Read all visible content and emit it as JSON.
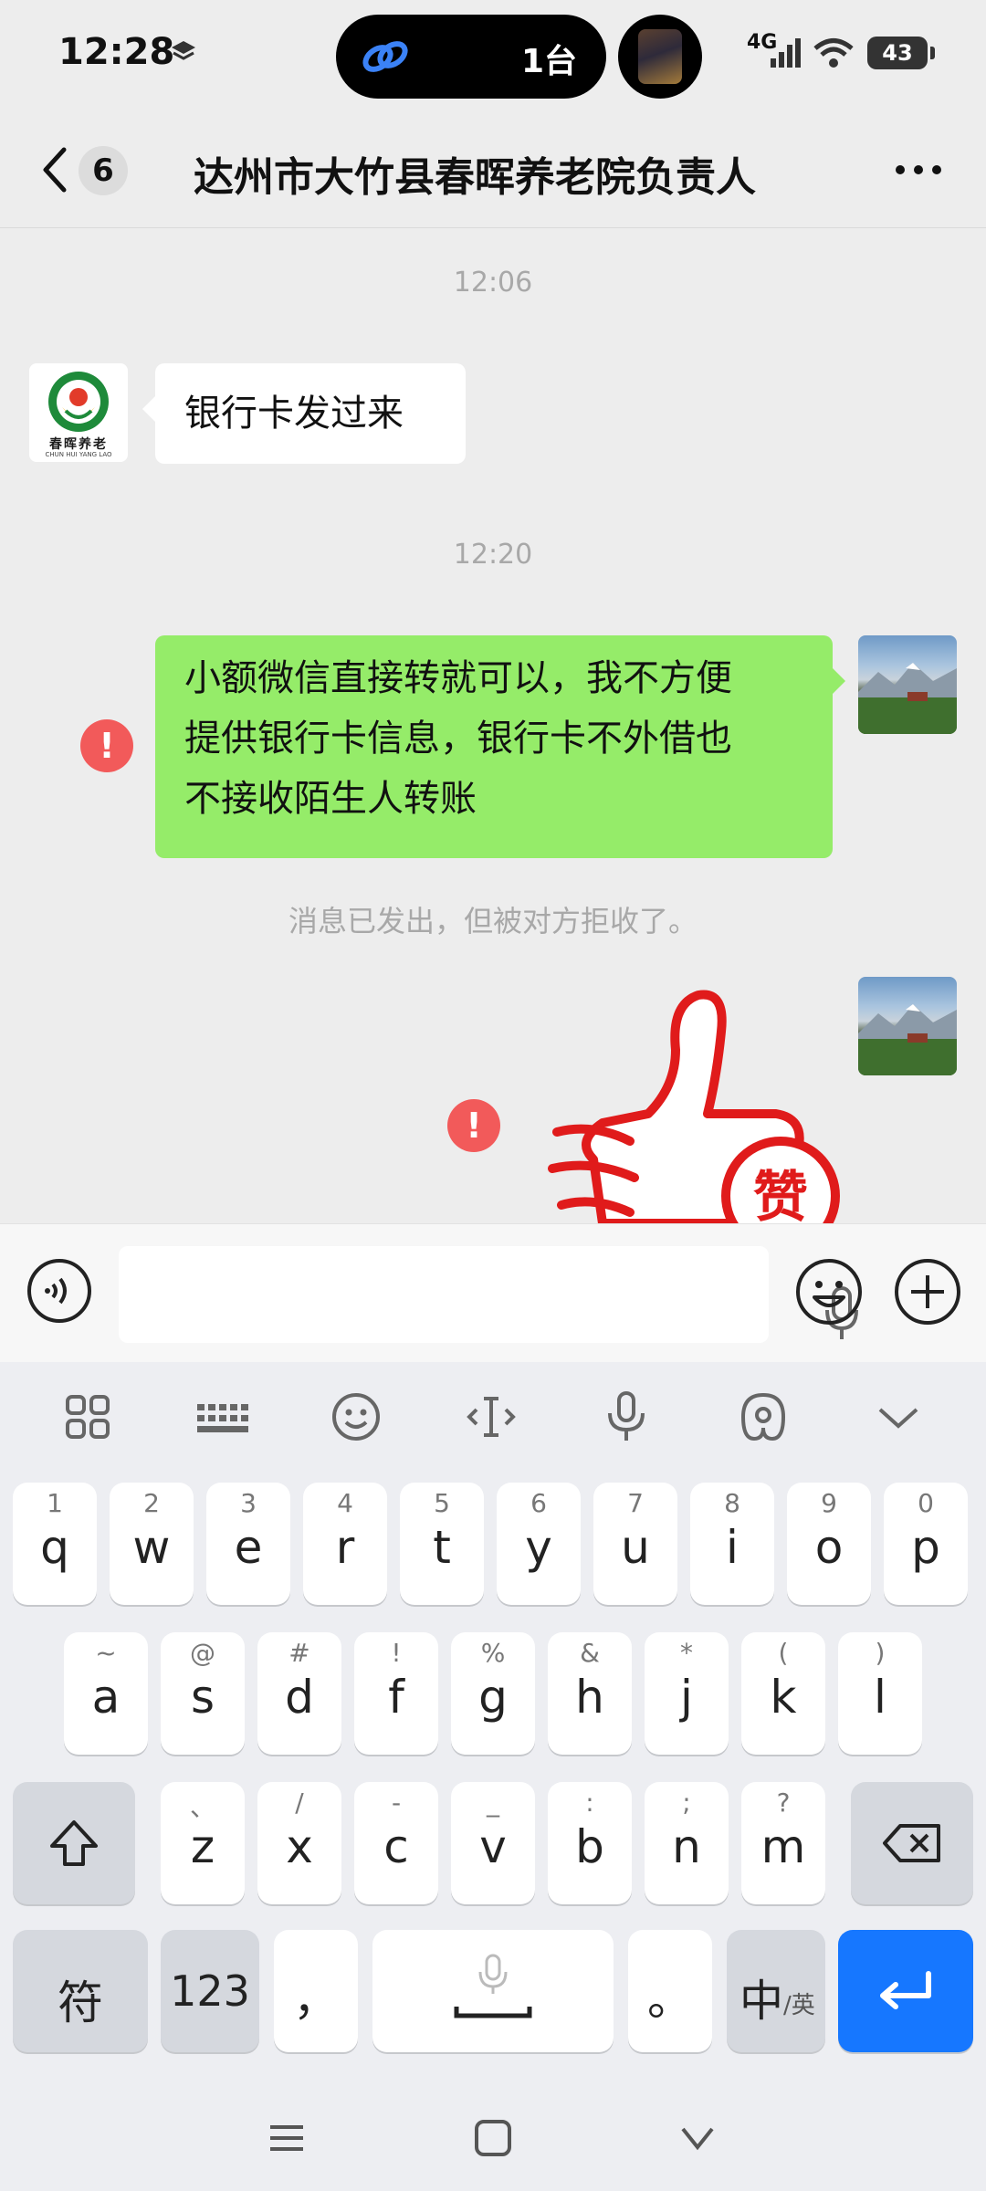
{
  "status_bar": {
    "time": "12:28",
    "island_label": "1台",
    "network": "4G",
    "battery": "43"
  },
  "header": {
    "unread_count": "6",
    "title": "达州市大竹县春晖养老院负责人"
  },
  "messages": {
    "ts1": "12:06",
    "msg1": "银行卡发过来",
    "avatar_logo_text": "春晖养老",
    "avatar_logo_sub": "CHUN HUI YANG LAO",
    "ts2": "12:20",
    "msg2_line1": "小额微信直接转就可以，我不方便",
    "msg2_line2": "提供银行卡信息，银行卡不外借也",
    "msg2_line3": "不接收陌生人转账",
    "rejected_notice": "消息已发出，但被对方拒收了。",
    "error_mark": "!",
    "sticker_text": "赞"
  },
  "keyboard": {
    "row1": [
      {
        "hint": "1",
        "key": "q"
      },
      {
        "hint": "2",
        "key": "w"
      },
      {
        "hint": "3",
        "key": "e"
      },
      {
        "hint": "4",
        "key": "r"
      },
      {
        "hint": "5",
        "key": "t"
      },
      {
        "hint": "6",
        "key": "y"
      },
      {
        "hint": "7",
        "key": "u"
      },
      {
        "hint": "8",
        "key": "i"
      },
      {
        "hint": "9",
        "key": "o"
      },
      {
        "hint": "0",
        "key": "p"
      }
    ],
    "row2": [
      {
        "hint": "~",
        "key": "a"
      },
      {
        "hint": "@",
        "key": "s"
      },
      {
        "hint": "#",
        "key": "d"
      },
      {
        "hint": "!",
        "key": "f"
      },
      {
        "hint": "%",
        "key": "g"
      },
      {
        "hint": "&",
        "key": "h"
      },
      {
        "hint": "*",
        "key": "j"
      },
      {
        "hint": "(",
        "key": "k"
      },
      {
        "hint": ")",
        "key": "l"
      }
    ],
    "row3": [
      {
        "hint": "、",
        "key": "z"
      },
      {
        "hint": "/",
        "key": "x"
      },
      {
        "hint": "-",
        "key": "c"
      },
      {
        "hint": "_",
        "key": "v"
      },
      {
        "hint": ":",
        "key": "b"
      },
      {
        "hint": ";",
        "key": "n"
      },
      {
        "hint": "?",
        "key": "m"
      }
    ],
    "sym": "符",
    "num": "123",
    "comma": "，",
    "period": "。",
    "lang_main": "中",
    "lang_sub": "/英"
  }
}
